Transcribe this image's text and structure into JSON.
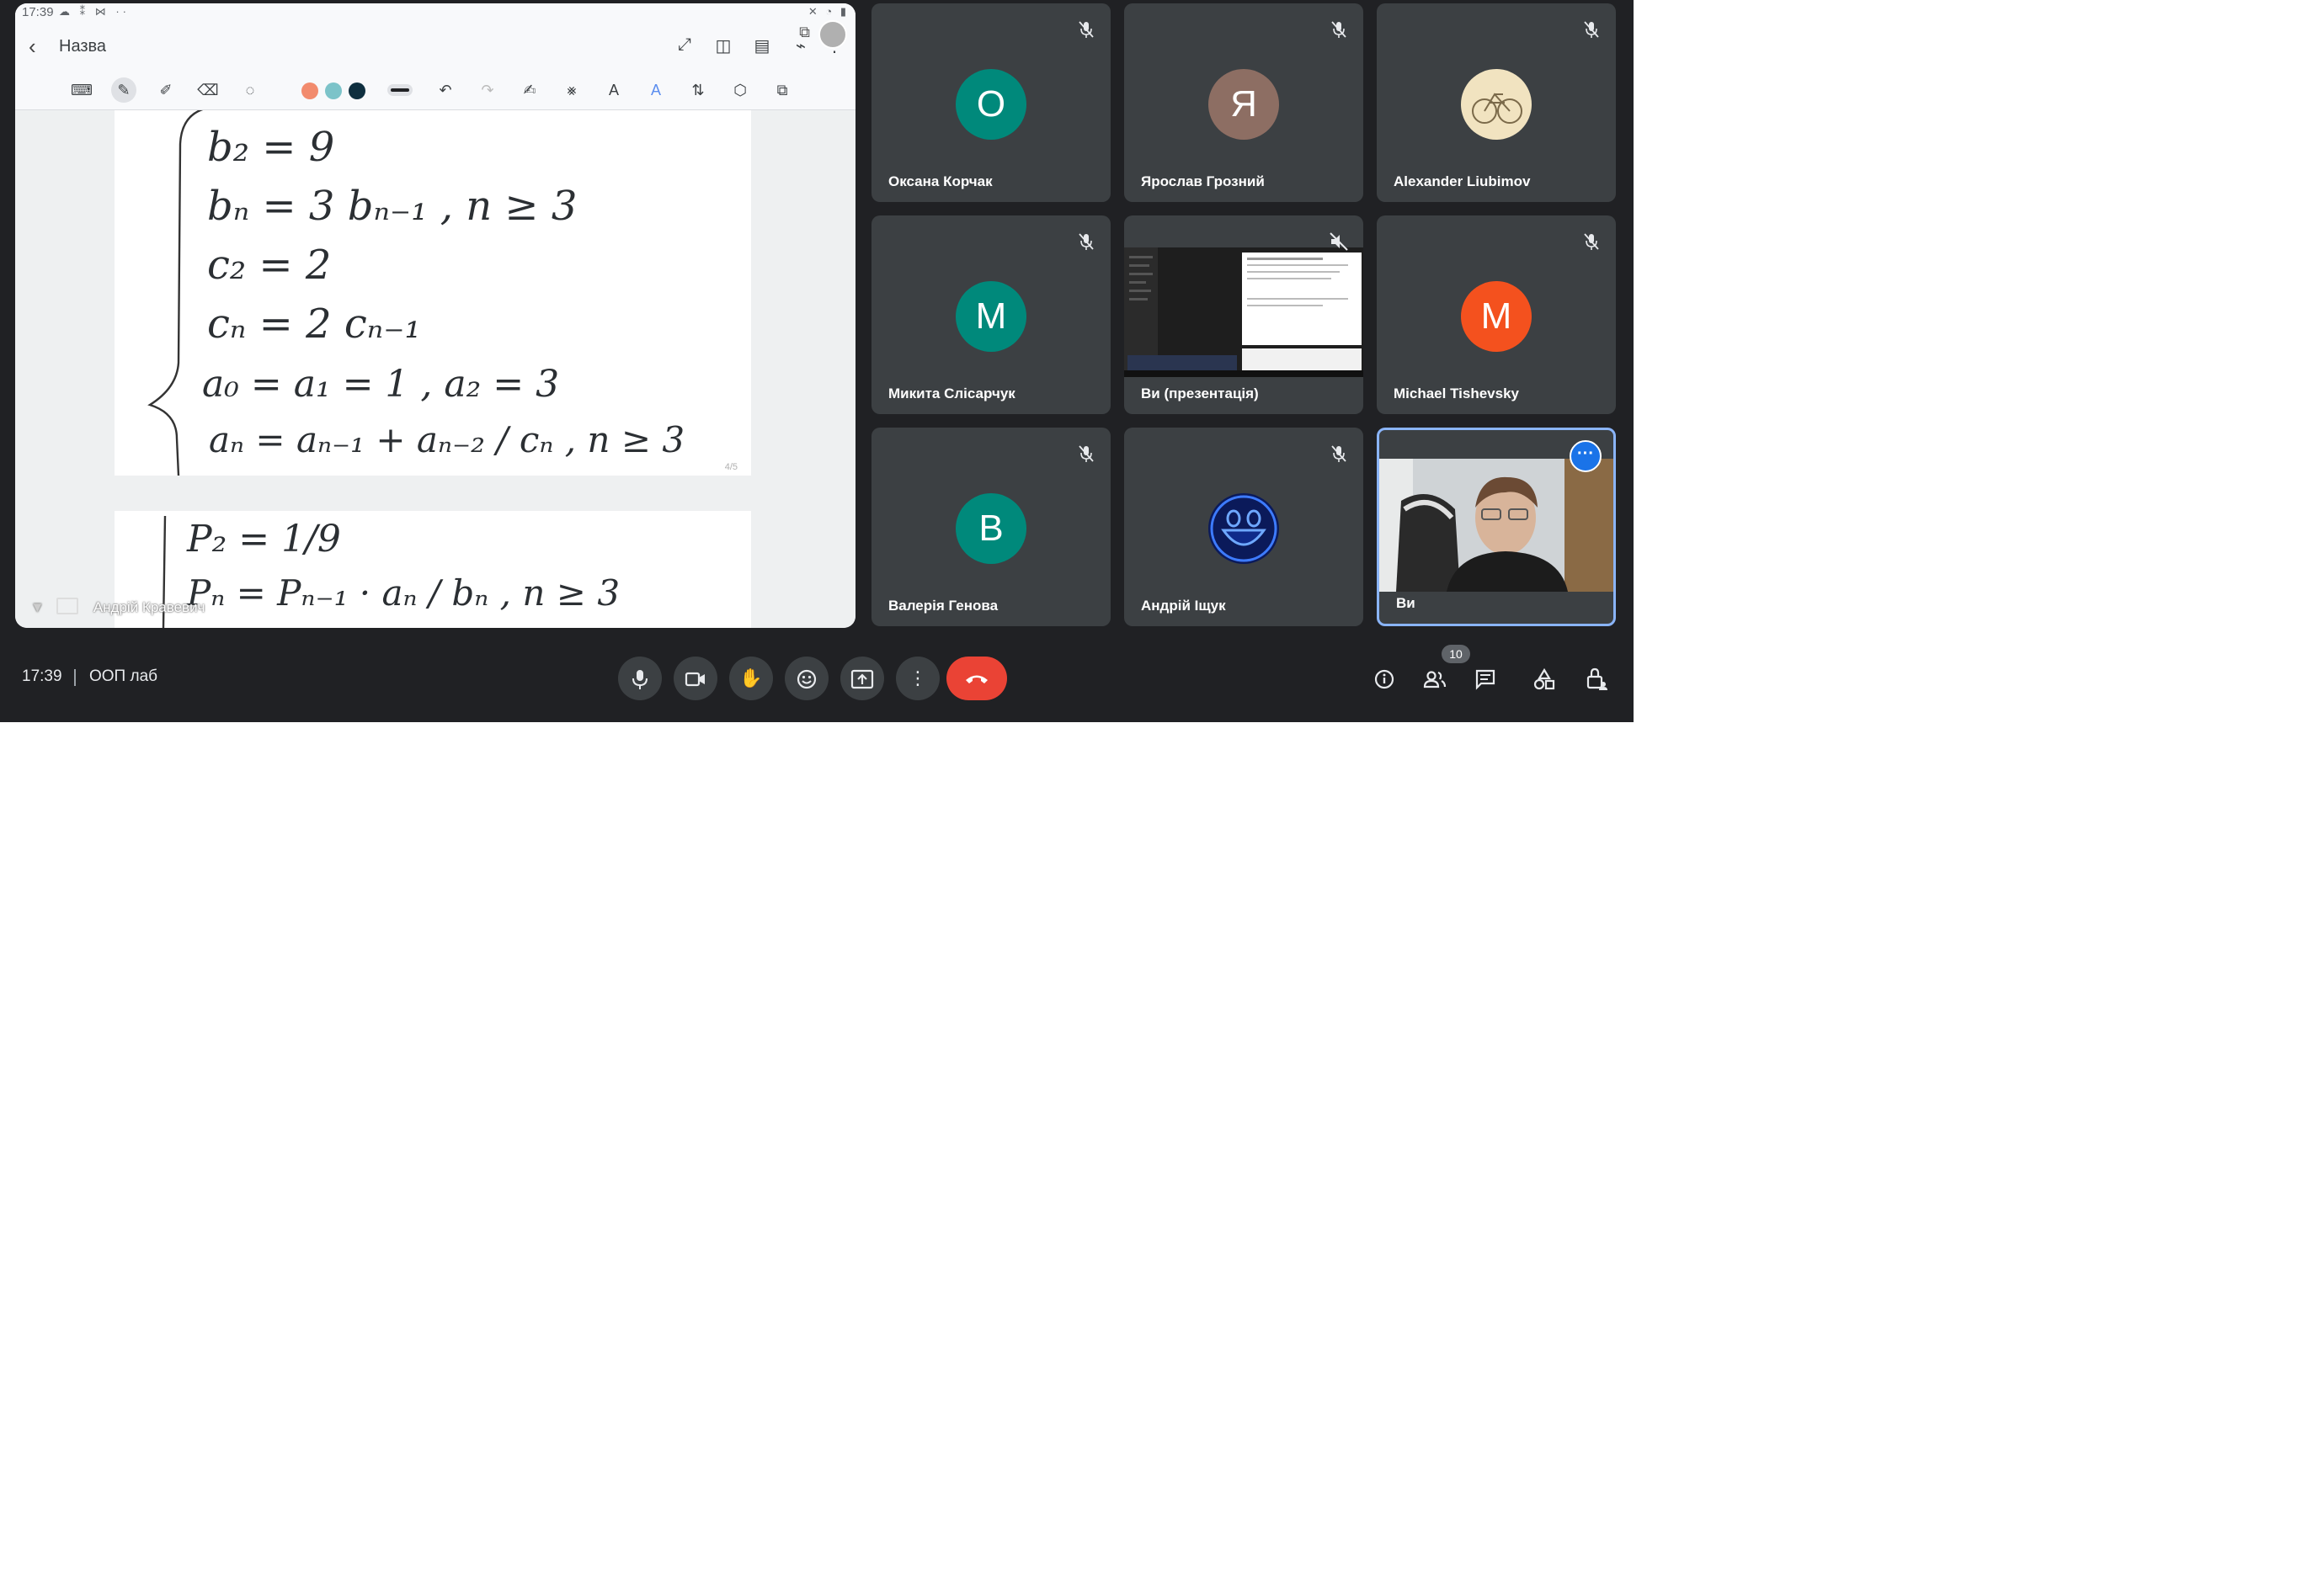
{
  "presentation": {
    "status_time": "17:39",
    "status_icons": "☁ ⁑ ⋈ ··",
    "back_label": "Назва",
    "page_number": "4/5",
    "presenter_watermark": "Андрій Кравевич",
    "pen_colors": [
      "#f28b6d",
      "#7cc3c9",
      "#0f2f3f"
    ],
    "formulas_page1": [
      "b₂ = 9",
      "bₙ = 3 bₙ₋₁ , n ≥ 3",
      "c₂ = 2",
      "cₙ = 2 cₙ₋₁",
      "a₀ = a₁ = 1 , a₂ = 3",
      "aₙ = aₙ₋₁ + aₙ₋₂ / cₙ , n ≥ 3"
    ],
    "formulas_page2": [
      "P₂ = 1/9",
      "Pₙ = Pₙ₋₁ · aₙ / bₙ , n ≥ 3"
    ]
  },
  "tiles": [
    {
      "name": "Оксана Корчак",
      "initial": "О",
      "color": "#00897b"
    },
    {
      "name": "Ярослав Грозний",
      "initial": "Я",
      "color": "#8d6e63"
    },
    {
      "name": "Alexander Liubimov",
      "initial": "",
      "color": "#f1e3c0"
    },
    {
      "name": "Микита Слісарчук",
      "initial": "М",
      "color": "#00897b"
    },
    {
      "name": "Ви (презентація)",
      "initial": "",
      "color": "#202124"
    },
    {
      "name": "Michael Tishevsky",
      "initial": "M",
      "color": "#f4511e"
    },
    {
      "name": "Валерія Генова",
      "initial": "В",
      "color": "#00897b"
    },
    {
      "name": "Андрій Іщук",
      "initial": "",
      "color": "#0b1a5a"
    },
    {
      "name": "Ви",
      "initial": "",
      "color": "#5a5a5a"
    }
  ],
  "bottom_bar": {
    "time": "17:39",
    "meeting_name": "ООП лаб",
    "participants_count": "10"
  }
}
